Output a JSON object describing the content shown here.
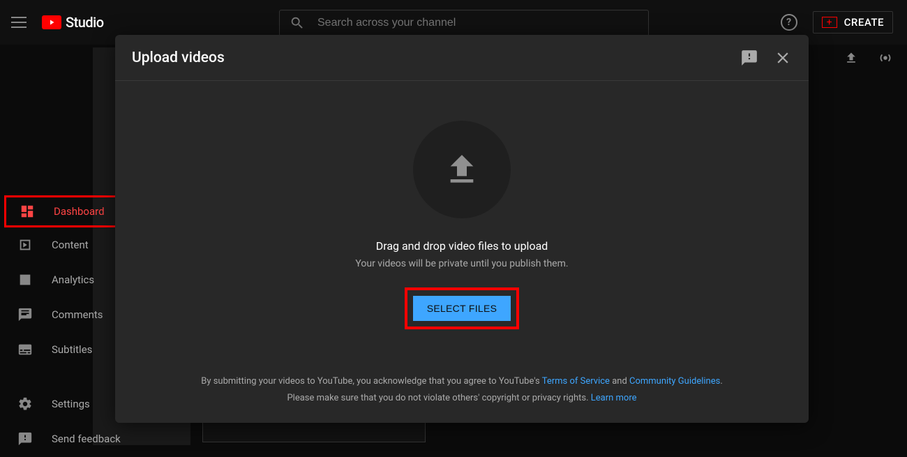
{
  "header": {
    "logo_text": "Studio",
    "search_placeholder": "Search across your channel",
    "create_label": "CREATE"
  },
  "sidebar": {
    "items": [
      {
        "label": "Dashboard"
      },
      {
        "label": "Content"
      },
      {
        "label": "Analytics"
      },
      {
        "label": "Comments"
      },
      {
        "label": "Subtitles"
      }
    ],
    "bottom": [
      {
        "label": "Settings"
      },
      {
        "label": "Send feedback"
      }
    ]
  },
  "modal": {
    "title": "Upload videos",
    "drag_title": "Drag and drop video files to upload",
    "drag_subtitle": "Your videos will be private until you publish them.",
    "select_button": "SELECT FILES",
    "footer_prefix": "By submitting your videos to YouTube, you acknowledge that you agree to YouTube's ",
    "tos": "Terms of Service",
    "and": " and ",
    "guidelines": "Community Guidelines",
    "period": ".",
    "copyright_line": "Please make sure that you do not violate others' copyright or privacy rights. ",
    "learn_more": "Learn more"
  }
}
